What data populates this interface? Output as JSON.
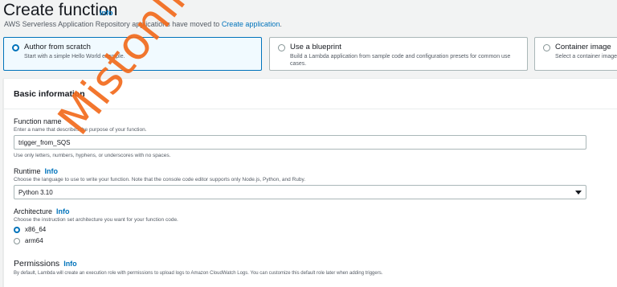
{
  "header": {
    "title": "Create function",
    "info": "Info",
    "notice_prefix": "AWS Serverless Application Repository applications have moved to ",
    "notice_link": "Create application",
    "notice_suffix": "."
  },
  "options": [
    {
      "title": "Author from scratch",
      "desc": "Start with a simple Hello World example.",
      "selected": true
    },
    {
      "title": "Use a blueprint",
      "desc": "Build a Lambda application from sample code and configuration presets for common use cases.",
      "selected": false
    },
    {
      "title": "Container image",
      "desc": "Select a container image to",
      "selected": false
    }
  ],
  "basic": {
    "title": "Basic information",
    "function_name": {
      "label": "Function name",
      "desc": "Enter a name that describes the purpose of your function.",
      "value": "trigger_from_SQS",
      "hint": "Use only letters, numbers, hyphens, or underscores with no spaces."
    },
    "runtime": {
      "label": "Runtime",
      "info": "Info",
      "desc": "Choose the language to use to write your function. Note that the console code editor supports only Node.js, Python, and Ruby.",
      "value": "Python 3.10"
    },
    "architecture": {
      "label": "Architecture",
      "info": "Info",
      "desc": "Choose the instruction set architecture you want for your function code.",
      "options": [
        "x86_64",
        "arm64"
      ],
      "selected": "x86_64"
    },
    "permissions": {
      "title": "Permissions",
      "info": "Info",
      "desc": "By default, Lambda will create an execution role with permissions to upload logs to Amazon CloudWatch Logs. You can customize this default role later when adding triggers."
    }
  },
  "watermark": "Mistonline.in",
  "colors": {
    "accent": "#0073bb",
    "watermark": "#f26b1d"
  }
}
